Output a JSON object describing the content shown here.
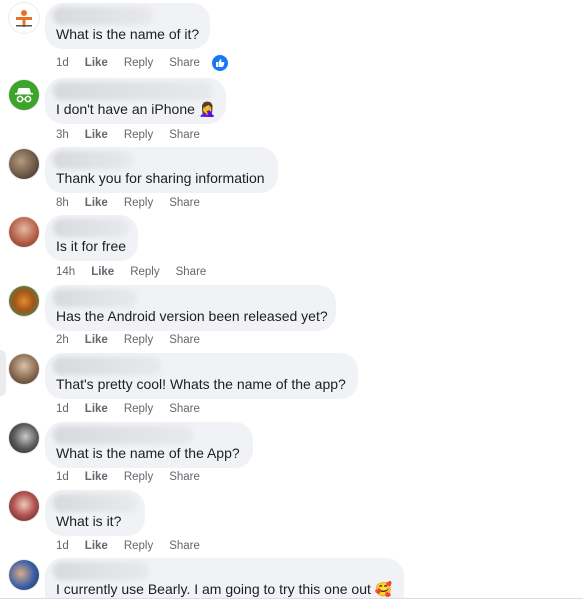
{
  "colors": {
    "bubble": "#f0f2f5",
    "accent": "#1877f2",
    "meta": "#65676b"
  },
  "comments": [
    {
      "text": "What is the name of it?",
      "time": "1d",
      "like": "Like",
      "reply": "Reply",
      "share": "Share",
      "reaction": "like-reaction-icon"
    },
    {
      "text": "I don't have an iPhone 🤦‍♀️",
      "time": "3h",
      "like": "Like",
      "reply": "Reply",
      "share": "Share"
    },
    {
      "text": "Thank you for sharing information",
      "time": "8h",
      "like": "Like",
      "reply": "Reply",
      "share": "Share"
    },
    {
      "text": "Is it for free",
      "time": "14h",
      "like": "Like",
      "reply": "Reply",
      "share": "Share"
    },
    {
      "text": "Has the Android version been released yet?",
      "time": "2h",
      "like": "Like",
      "reply": "Reply",
      "share": "Share"
    },
    {
      "text": "That's pretty cool! Whats the name of the app?",
      "time": "1d",
      "like": "Like",
      "reply": "Reply",
      "share": "Share"
    },
    {
      "text": "What is the name of the App?",
      "time": "1d",
      "like": "Like",
      "reply": "Reply",
      "share": "Share"
    },
    {
      "text": "What is it?",
      "time": "1d",
      "like": "Like",
      "reply": "Reply",
      "share": "Share"
    },
    {
      "text": "I currently use Bearly. I am going to try this one out 🥰",
      "time": "",
      "like": "",
      "reply": "",
      "share": ""
    }
  ]
}
